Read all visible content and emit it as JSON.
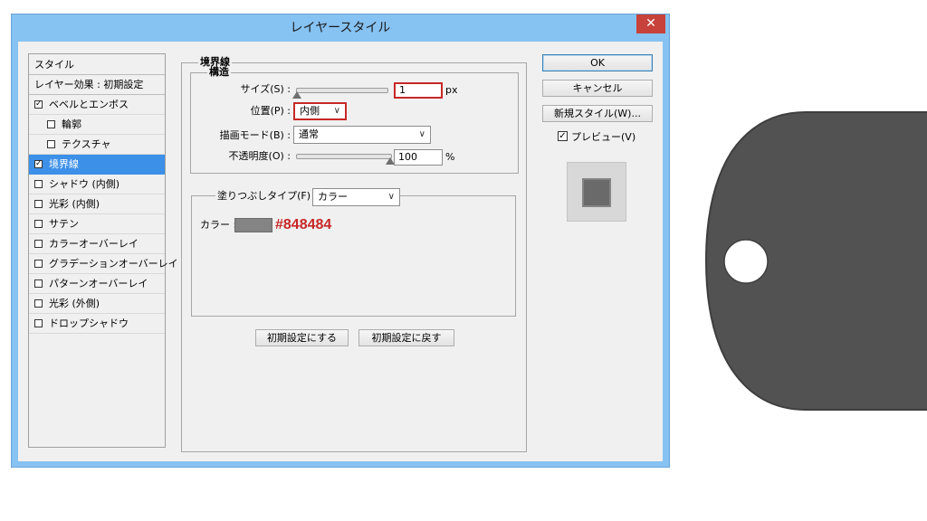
{
  "window": {
    "title": "レイヤースタイル",
    "close_glyph": "✕"
  },
  "style_list": {
    "header": "スタイル",
    "blend_defaults": "レイヤー効果 : 初期設定",
    "items": [
      {
        "label": "ベベルとエンボス",
        "checked": true,
        "indent": false,
        "selected": false
      },
      {
        "label": "輪郭",
        "checked": false,
        "indent": true,
        "selected": false
      },
      {
        "label": "テクスチャ",
        "checked": false,
        "indent": true,
        "selected": false
      },
      {
        "label": "境界線",
        "checked": true,
        "indent": false,
        "selected": true
      },
      {
        "label": "シャドウ (内側)",
        "checked": false,
        "indent": false,
        "selected": false
      },
      {
        "label": "光彩 (内側)",
        "checked": false,
        "indent": false,
        "selected": false
      },
      {
        "label": "サテン",
        "checked": false,
        "indent": false,
        "selected": false
      },
      {
        "label": "カラーオーバーレイ",
        "checked": false,
        "indent": false,
        "selected": false
      },
      {
        "label": "グラデーションオーバーレイ",
        "checked": false,
        "indent": false,
        "selected": false
      },
      {
        "label": "パターンオーバーレイ",
        "checked": false,
        "indent": false,
        "selected": false
      },
      {
        "label": "光彩 (外側)",
        "checked": false,
        "indent": false,
        "selected": false
      },
      {
        "label": "ドロップシャドウ",
        "checked": false,
        "indent": false,
        "selected": false
      }
    ]
  },
  "stroke": {
    "section_title": "境界線",
    "structure_title": "構造",
    "size_label": "サイズ(S) :",
    "size_value": "1",
    "size_unit": "px",
    "size_slider_fraction": 0.01,
    "position_label": "位置(P) :",
    "position_value": "内側",
    "blend_label": "描画モード(B) :",
    "blend_value": "通常",
    "opacity_label": "不透明度(O) :",
    "opacity_value": "100",
    "opacity_unit": "%",
    "opacity_slider_fraction": 1.0,
    "fill_type_label": "塗りつぶしタイプ(F) :",
    "fill_type_value": "カラー",
    "color_label": "カラー :",
    "color_hex_text": "#848484",
    "color_value": "#848484",
    "make_default_button": "初期設定にする",
    "reset_default_button": "初期設定に戻す"
  },
  "buttons": {
    "ok": "OK",
    "cancel": "キャンセル",
    "new_style": "新規スタイル(W)..."
  },
  "preview": {
    "label": "プレビュー(V)",
    "checked": true
  },
  "colors": {
    "tag_fill": "#525252",
    "selection": "#3d90e8",
    "highlight_red": "#c62828"
  },
  "icons": {
    "close": "close-icon",
    "dropdown": "chevron-down-icon",
    "checkbox": "checkbox-icon"
  }
}
